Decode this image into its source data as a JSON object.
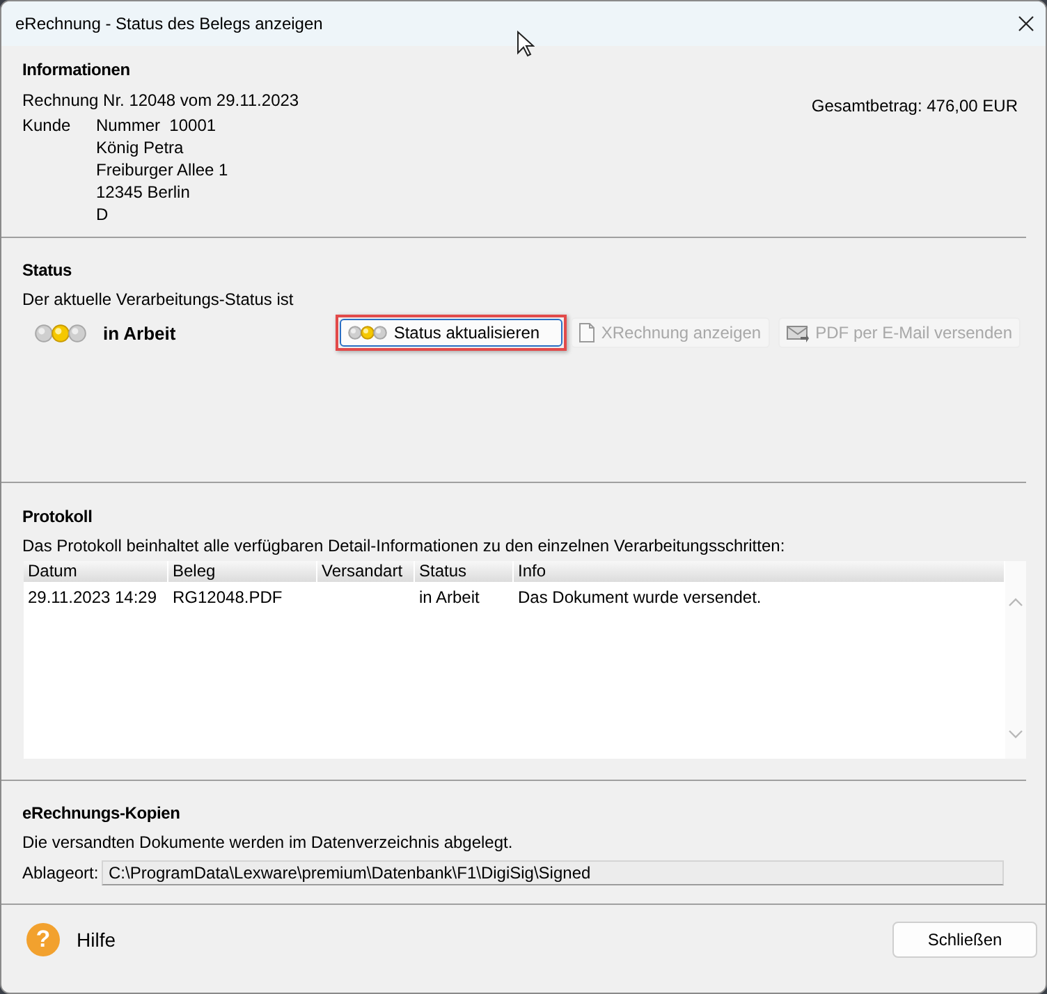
{
  "window": {
    "title": "eRechnung - Status des Belegs anzeigen"
  },
  "informationen": {
    "heading": "Informationen",
    "invoice": "Rechnung Nr. 12048 vom 29.11.2023",
    "total": "Gesamtbetrag: 476,00 EUR",
    "customer_label": "Kunde",
    "customer_lines": [
      "Nummer  10001",
      "König Petra",
      "Freiburger Allee 1",
      "12345 Berlin",
      "D"
    ]
  },
  "status": {
    "heading": "Status",
    "description": "Der aktuelle Verarbeitungs-Status ist",
    "lamps": [
      {
        "on": false
      },
      {
        "on": true
      },
      {
        "on": false
      }
    ],
    "state": "in Arbeit",
    "buttons": [
      {
        "label": "Status aktualisieren",
        "kind": "lamps",
        "disabled": false,
        "highlighted": true
      },
      {
        "label": "XRechnung anzeigen",
        "kind": "document",
        "disabled": true,
        "highlighted": false
      },
      {
        "label": "PDF per E-Mail versenden",
        "kind": "mail",
        "disabled": true,
        "highlighted": false
      }
    ]
  },
  "protokoll": {
    "heading": "Protokoll",
    "description": "Das Protokoll beinhaltet alle verfügbaren Detail-Informationen zu den einzelnen Verarbeitungsschritten:",
    "table": {
      "columns": [
        "Datum",
        "Beleg",
        "Versandart",
        "Status",
        "Info"
      ],
      "rows": [
        [
          "29.11.2023 14:29",
          "RG12048.PDF",
          null,
          "in Arbeit",
          "Das Dokument wurde versendet."
        ]
      ]
    }
  },
  "kopien": {
    "heading": "eRechnungs-Kopien",
    "description": "Die versandten Dokumente werden im Datenverzeichnis abgelegt.",
    "location_label": "Ablageort:",
    "location_value": "C:\\ProgramData\\Lexware\\premium\\Datenbank\\F1\\DigiSig\\Signed"
  },
  "footer": {
    "help_icon": "?",
    "help_label": "Hilfe",
    "close_button": "Schließen"
  }
}
